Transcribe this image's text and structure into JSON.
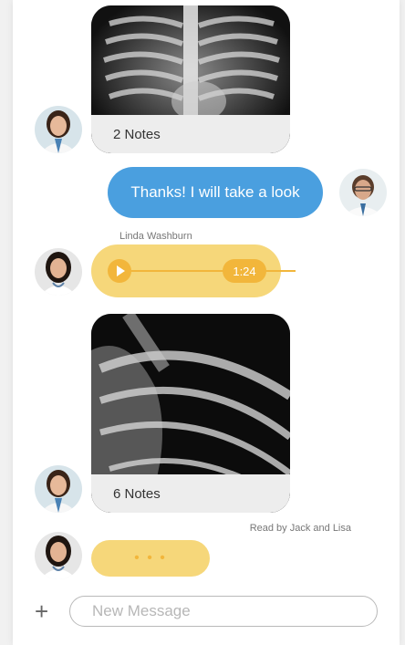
{
  "chat": {
    "image1_notes": "2 Notes",
    "sent_message": "Thanks! I will take a look",
    "sender_name": "Linda Washburn",
    "audio_duration": "1:24",
    "image2_notes": "6 Notes",
    "read_receipt": "Read by Jack and Lisa",
    "typing_indicator": "• • •"
  },
  "composer": {
    "add_icon": "+",
    "placeholder": "New Message"
  },
  "colors": {
    "blue_bubble": "#4a9fdf",
    "yellow_bubble": "#f6d77a",
    "yellow_accent": "#f2b63b"
  }
}
